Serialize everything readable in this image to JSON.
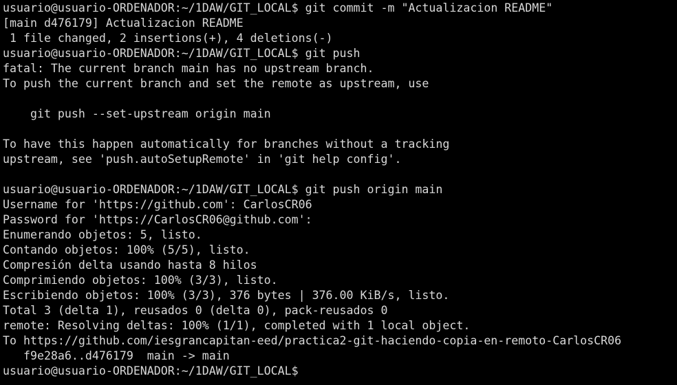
{
  "terminal": {
    "colors": {
      "background": "#000000",
      "foreground": "#d8d8d8"
    },
    "prompt": "usuario@usuario-ORDENADOR:~/1DAW/GIT_LOCAL$",
    "lines": [
      {
        "kind": "prompt",
        "command": " git commit -m \"Actualizacion README\""
      },
      {
        "kind": "output",
        "text": "[main d476179] Actualizacion README"
      },
      {
        "kind": "output",
        "text": " 1 file changed, 2 insertions(+), 4 deletions(-)"
      },
      {
        "kind": "prompt",
        "command": " git push"
      },
      {
        "kind": "output",
        "text": "fatal: The current branch main has no upstream branch."
      },
      {
        "kind": "output",
        "text": "To push the current branch and set the remote as upstream, use"
      },
      {
        "kind": "output",
        "text": ""
      },
      {
        "kind": "output",
        "text": "    git push --set-upstream origin main"
      },
      {
        "kind": "output",
        "text": ""
      },
      {
        "kind": "output",
        "text": "To have this happen automatically for branches without a tracking"
      },
      {
        "kind": "output",
        "text": "upstream, see 'push.autoSetupRemote' in 'git help config'."
      },
      {
        "kind": "output",
        "text": ""
      },
      {
        "kind": "prompt",
        "command": " git push origin main"
      },
      {
        "kind": "output",
        "text": "Username for 'https://github.com': CarlosCR06"
      },
      {
        "kind": "output",
        "text": "Password for 'https://CarlosCR06@github.com':"
      },
      {
        "kind": "output",
        "text": "Enumerando objetos: 5, listo."
      },
      {
        "kind": "output",
        "text": "Contando objetos: 100% (5/5), listo."
      },
      {
        "kind": "output",
        "text": "Compresión delta usando hasta 8 hilos"
      },
      {
        "kind": "output",
        "text": "Comprimiendo objetos: 100% (3/3), listo."
      },
      {
        "kind": "output",
        "text": "Escribiendo objetos: 100% (3/3), 376 bytes | 376.00 KiB/s, listo."
      },
      {
        "kind": "output",
        "text": "Total 3 (delta 1), reusados 0 (delta 0), pack-reusados 0"
      },
      {
        "kind": "output",
        "text": "remote: Resolving deltas: 100% (1/1), completed with 1 local object."
      },
      {
        "kind": "output",
        "text": "To https://github.com/iesgrancapitan-eed/practica2-git-haciendo-copia-en-remoto-CarlosCR06"
      },
      {
        "kind": "output",
        "text": "   f9e28a6..d476179  main -> main"
      },
      {
        "kind": "prompt",
        "command": " "
      }
    ]
  }
}
